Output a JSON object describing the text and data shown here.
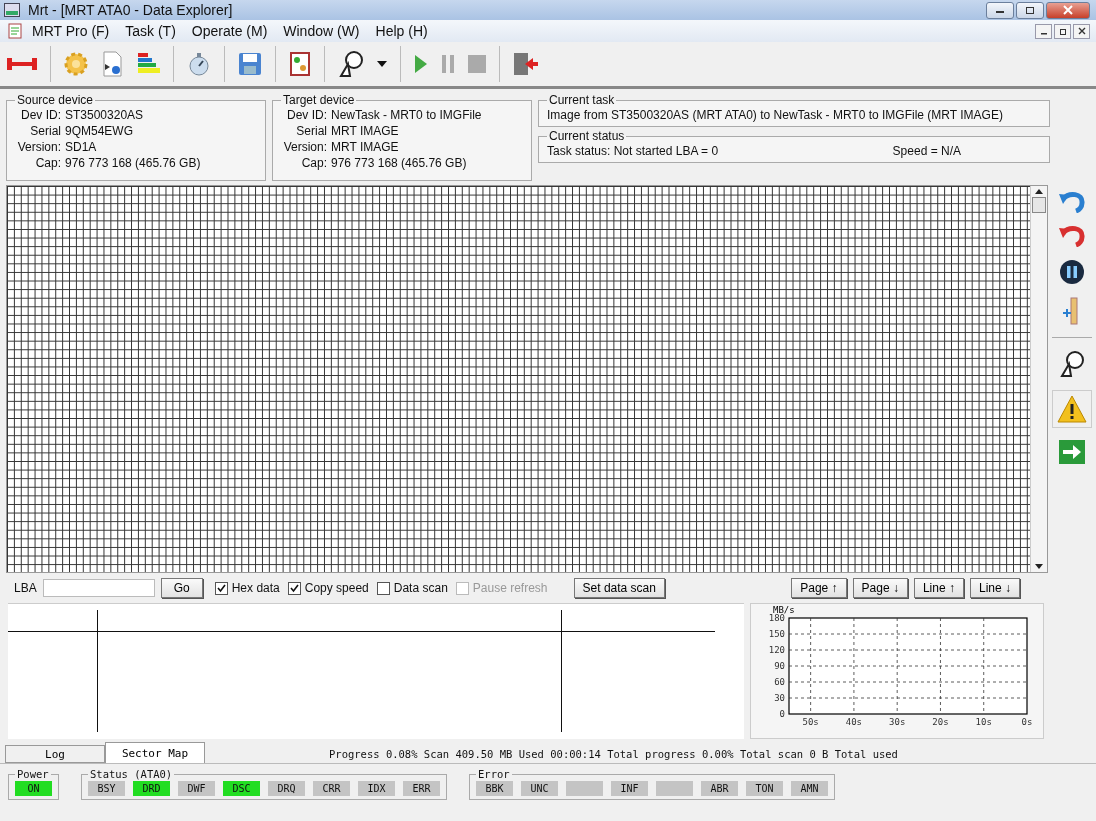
{
  "window": {
    "title": "Mrt - [MRT ATA0 - Data Explorer]"
  },
  "menu": [
    "MRT Pro (F)",
    "Task (T)",
    "Operate (M)",
    "Window (W)",
    "Help (H)"
  ],
  "toolbar": [
    {
      "kind": "connect"
    },
    {
      "kind": "sep"
    },
    {
      "kind": "gear"
    },
    {
      "kind": "info"
    },
    {
      "kind": "bars"
    },
    {
      "kind": "sep"
    },
    {
      "kind": "timer"
    },
    {
      "kind": "sep"
    },
    {
      "kind": "save"
    },
    {
      "kind": "sep"
    },
    {
      "kind": "doc"
    },
    {
      "kind": "sep"
    },
    {
      "kind": "probe"
    },
    {
      "kind": "dropdown"
    },
    {
      "kind": "sep"
    },
    {
      "kind": "play"
    },
    {
      "kind": "pause"
    },
    {
      "kind": "stop"
    },
    {
      "kind": "sep"
    },
    {
      "kind": "exit"
    }
  ],
  "source_device": {
    "title": "Source device",
    "lines": [
      {
        "label": "Dev ID:",
        "value": "ST3500320AS"
      },
      {
        "label": "Serial",
        "value": "9QM54EWG"
      },
      {
        "label": "Version:",
        "value": "SD1A"
      },
      {
        "label": "Cap:",
        "value": "976 773 168 (465.76 GB)"
      }
    ]
  },
  "target_device": {
    "title": "Target device",
    "lines": [
      {
        "label": "Dev ID:",
        "value": "NewTask - MRT0 to IMGFile"
      },
      {
        "label": "Serial",
        "value": "MRT IMAGE"
      },
      {
        "label": "Version:",
        "value": "MRT IMAGE"
      },
      {
        "label": "Cap:",
        "value": "976 773 168 (465.76 GB)"
      }
    ]
  },
  "current_task": {
    "title": "Current task",
    "text": "Image from ST3500320AS (MRT ATA0) to NewTask - MRT0 to IMGFile (MRT IMAGE)"
  },
  "current_status": {
    "title": "Current status",
    "status": "Task status: Not started  LBA = 0",
    "speed": "Speed = N/A"
  },
  "side_tools": [
    {
      "kind": "undo"
    },
    {
      "kind": "redo"
    },
    {
      "kind": "pause"
    },
    {
      "kind": "ruler"
    },
    {
      "kind": "sep"
    },
    {
      "kind": "probe"
    },
    {
      "kind": "warning"
    },
    {
      "kind": "arrow"
    }
  ],
  "controls": {
    "lba_label": "LBA",
    "go": "Go",
    "checkboxes": [
      {
        "label": "Hex data",
        "checked": true,
        "disabled": false
      },
      {
        "label": "Copy speed",
        "checked": true,
        "disabled": false
      },
      {
        "label": "Data scan",
        "checked": false,
        "disabled": false
      },
      {
        "label": "Pause refresh",
        "checked": false,
        "disabled": true
      }
    ],
    "set_scan": "Set data scan",
    "nav": [
      "Page ↑",
      "Page ↓",
      "Line ↑",
      "Line ↓"
    ]
  },
  "speed_chart": {
    "chart_data": {
      "type": "line",
      "grid": true,
      "ylabel": "MB/s",
      "xlim": [
        55,
        0
      ],
      "ylim": [
        0,
        180
      ],
      "yticks": [
        0,
        30,
        60,
        90,
        120,
        150,
        180
      ],
      "xticks": [
        {
          "value": 50,
          "label": "50s"
        },
        {
          "value": 40,
          "label": "40s"
        },
        {
          "value": 30,
          "label": "30s"
        },
        {
          "value": 20,
          "label": "20s"
        },
        {
          "value": 10,
          "label": "10s"
        },
        {
          "value": 0,
          "label": "0s"
        }
      ]
    }
  },
  "tabs": [
    {
      "label": "Log",
      "selected": false
    },
    {
      "label": "Sector Map",
      "selected": true
    }
  ],
  "progress": "Progress 0.08% Scan 409.50 MB Used 00:00:14   Total progress 0.00% Total scan 0 B Total used",
  "power": {
    "title": "Power",
    "indicators": [
      {
        "label": "ON",
        "on": true
      }
    ]
  },
  "status": {
    "title": "Status (ATA0)",
    "indicators": [
      {
        "label": "BSY",
        "on": false
      },
      {
        "label": "DRD",
        "on": true
      },
      {
        "label": "DWF",
        "on": false
      },
      {
        "label": "DSC",
        "on": true
      },
      {
        "label": "DRQ",
        "on": false
      },
      {
        "label": "CRR",
        "on": false
      },
      {
        "label": "IDX",
        "on": false
      },
      {
        "label": "ERR",
        "on": false
      }
    ]
  },
  "error": {
    "title": "Error",
    "indicators": [
      {
        "label": "BBK",
        "on": false
      },
      {
        "label": "UNC",
        "on": false
      },
      {
        "on": false
      },
      {
        "label": "INF",
        "on": false
      },
      {
        "on": false
      },
      {
        "label": "ABR",
        "on": false
      },
      {
        "label": "TON",
        "on": false
      },
      {
        "label": "AMN",
        "on": false
      }
    ]
  }
}
